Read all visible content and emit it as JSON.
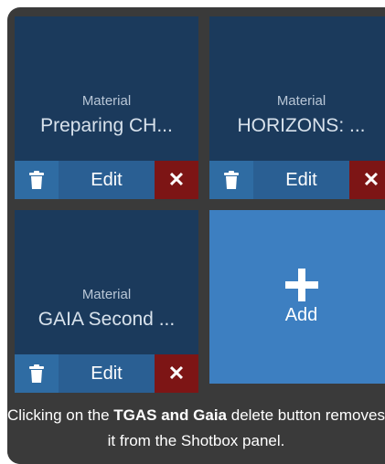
{
  "cards": [
    {
      "type": "Material",
      "name": "Preparing CH...",
      "edit_label": "Edit",
      "delete_icon": "trash-icon",
      "remove_icon": "close-icon"
    },
    {
      "type": "Material",
      "name": "HORIZONS: ...",
      "edit_label": "Edit",
      "delete_icon": "trash-icon",
      "remove_icon": "close-icon"
    },
    {
      "type": "Material",
      "name": "GAIA Second ...",
      "edit_label": "Edit",
      "delete_icon": "trash-icon",
      "remove_icon": "close-icon"
    }
  ],
  "add_card": {
    "label": "Add",
    "icon": "plus-icon"
  },
  "caption": {
    "before": "Clicking on the ",
    "highlight": "TGAS and Gaia",
    "after": " delete button removes it from the Shotbox panel."
  },
  "colors": {
    "card_bg": "#1b3a5c",
    "delete_btn": "#2f6ca3",
    "edit_btn": "#2a5f93",
    "remove_btn": "#7d1515",
    "add_card_bg": "#3d7fc1",
    "frame_bg": "#3a3a3a"
  }
}
